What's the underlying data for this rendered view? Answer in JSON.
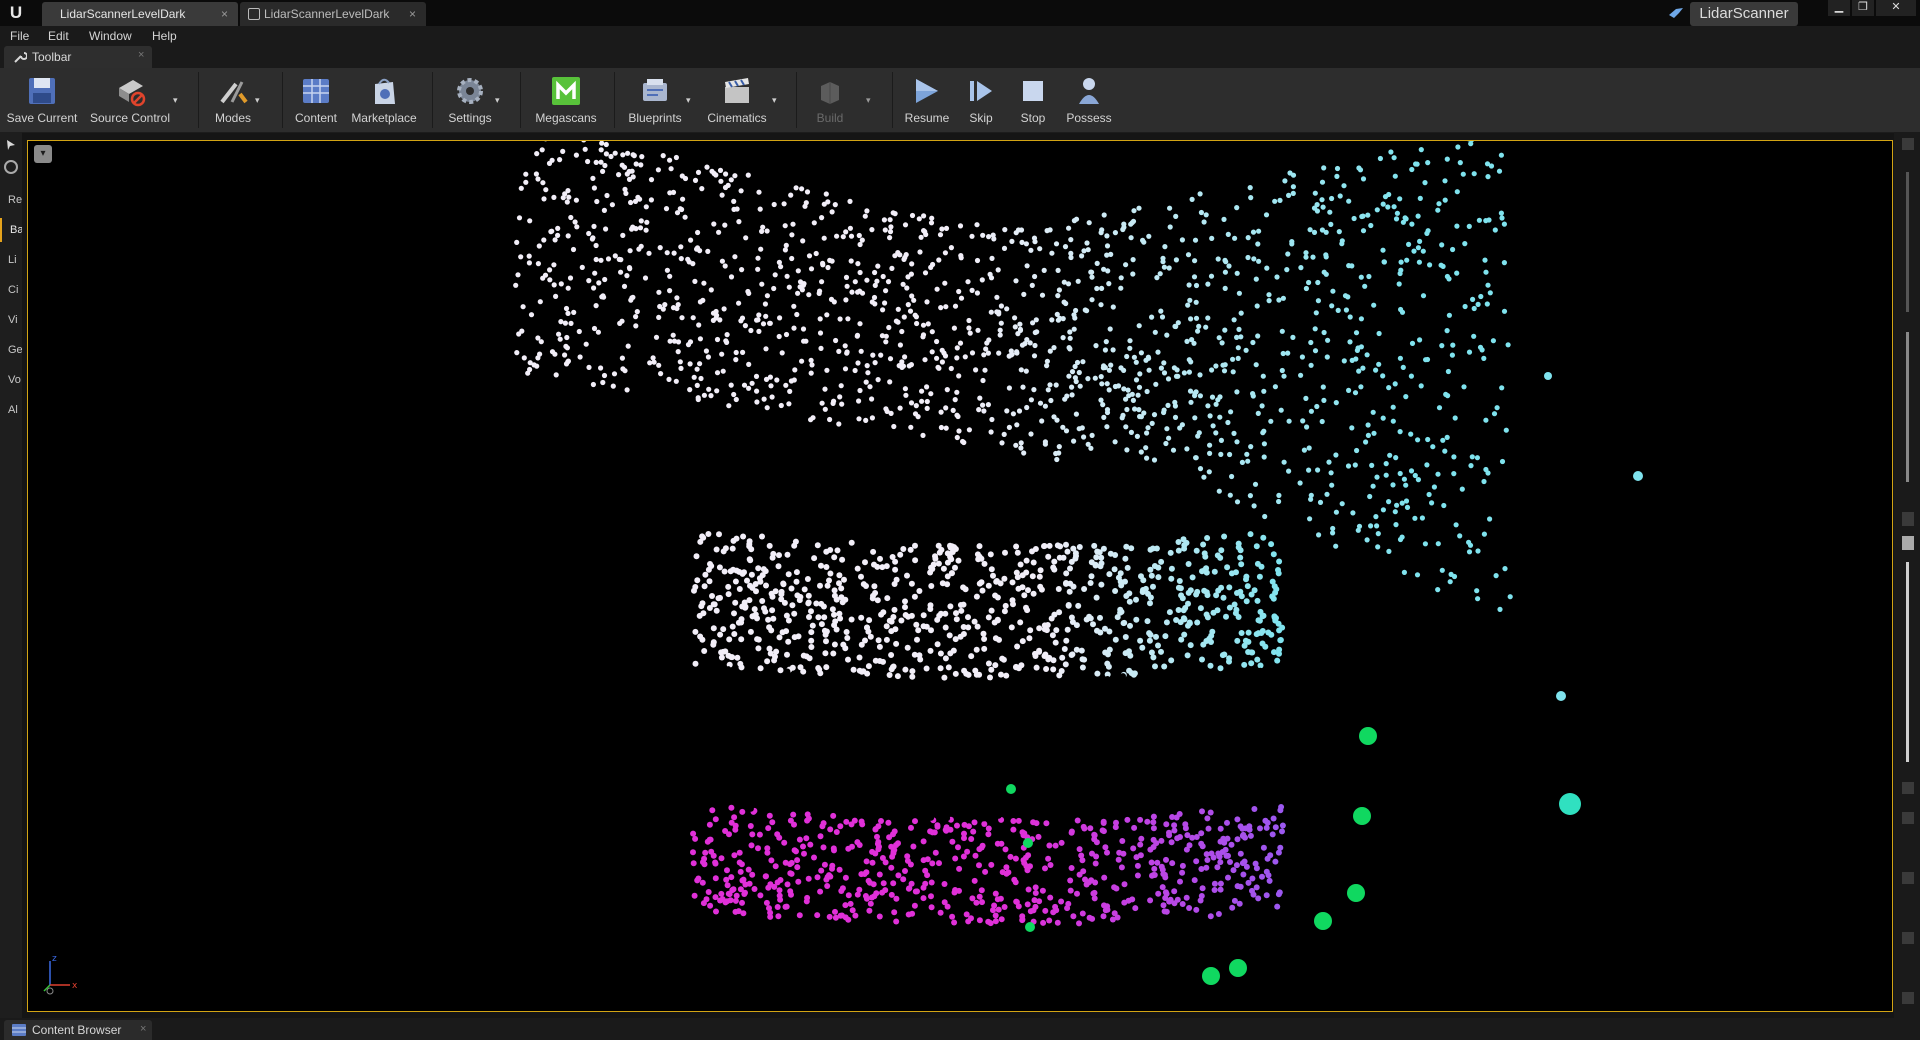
{
  "app": {
    "logo_glyph": "U",
    "tabs": [
      {
        "label": "LidarScannerLevelDark",
        "close": "×",
        "active": true
      },
      {
        "label": "LidarScannerLevelDark",
        "close": "×",
        "active": false
      }
    ],
    "project_name": "LidarScanner",
    "window_buttons": {
      "minimize": "▁",
      "restore": "❐",
      "close": "✕"
    }
  },
  "menu": [
    "File",
    "Edit",
    "Window",
    "Help"
  ],
  "toolbar_tab": {
    "label": "Toolbar",
    "close": "×"
  },
  "toolbar": {
    "save_current": "Save Current",
    "source_control": "Source Control",
    "modes": "Modes",
    "content": "Content",
    "marketplace": "Marketplace",
    "settings": "Settings",
    "megascans": "Megascans",
    "blueprints": "Blueprints",
    "cinematics": "Cinematics",
    "build": "Build",
    "resume": "Resume",
    "skip": "Skip",
    "stop": "Stop",
    "possess": "Possess",
    "dropdown_glyph": "▾"
  },
  "left_panel": {
    "tabs": [
      "Re",
      "Ba",
      "Li",
      "Ci",
      "Vi",
      "Ge",
      "Vo",
      "Al"
    ],
    "active_tab": "Ba"
  },
  "viewport": {
    "options_glyph": "▾",
    "axis": {
      "x": "x",
      "z": "z"
    },
    "colors": {
      "border": "#d2a414",
      "white_points": "#f2eef8",
      "cyan_points": "#7fe3ee",
      "yellow_points": "#f0e020",
      "magenta_points": "#e030d8",
      "violet_points": "#9c58f0",
      "green_points": "#10d860",
      "teal_points": "#30e0c0"
    }
  },
  "content_browser": {
    "label": "Content Browser",
    "close": "×"
  }
}
